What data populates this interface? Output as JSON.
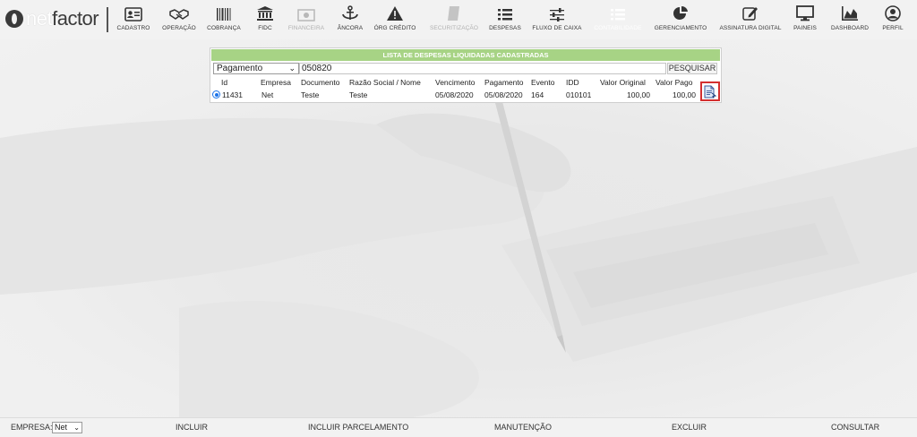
{
  "brand": {
    "logo_net": "net",
    "logo_factor": "factor"
  },
  "nav": [
    {
      "label": "CADASTRO",
      "icon": "id-card-icon"
    },
    {
      "label": "OPERAÇÃO",
      "icon": "handshake-icon"
    },
    {
      "label": "COBRANÇA",
      "icon": "barcode-icon"
    },
    {
      "label": "FIDC",
      "icon": "bank-icon"
    },
    {
      "label": "FINANCEIRA",
      "icon": "money-icon"
    },
    {
      "label": "ÂNCORA",
      "icon": "anchor-icon"
    },
    {
      "label": "ÓRG CRÉDITO",
      "icon": "warning-icon"
    },
    {
      "label": "SECURITIZAÇÃO",
      "icon": "document-icon"
    },
    {
      "label": "DESPESAS",
      "icon": "list-icon"
    },
    {
      "label": "FLUXO DE CAIXA",
      "icon": "sliders-icon"
    },
    {
      "label": "CONTABILIDADE",
      "icon": "list-icon"
    },
    {
      "label": "GERENCIAMENTO",
      "icon": "pie-chart-icon"
    },
    {
      "label": "ASSINATURA DIGITAL",
      "icon": "edit-icon"
    },
    {
      "label": "PAINEIS",
      "icon": "monitor-icon"
    },
    {
      "label": "DASHBOARD",
      "icon": "area-chart-icon"
    },
    {
      "label": "PERFIL",
      "icon": "user-icon"
    }
  ],
  "panel": {
    "title": "LISTA DE DESPESAS LIQUIDADAS CADASTRADAS",
    "filter_selected": "Pagamento",
    "search_value": "050820",
    "search_button": "PESQUISAR",
    "columns": [
      "Id",
      "Empresa",
      "Documento",
      "Razão Social / Nome",
      "Vencimento",
      "Pagamento",
      "Evento",
      "IDD",
      "Valor Original",
      "Valor Pago"
    ],
    "rows": [
      [
        "11431",
        "Net",
        "Teste",
        "Teste",
        "05/08/2020",
        "05/08/2020",
        "164",
        "010101",
        "100,00",
        "100,00"
      ]
    ]
  },
  "bottom": {
    "empresa_label": "EMPRESA:",
    "empresa_value": "Net",
    "incluir": "INCLUIR",
    "incluir_parcelamento": "INCLUIR PARCELAMENTO",
    "manutencao": "MANUTENÇÃO",
    "excluir": "EXCLUIR",
    "consultar": "CONSULTAR"
  },
  "colors": {
    "title_bar": "#a7d385",
    "highlight": "#d32f2f",
    "radio": "#1a73e8"
  }
}
